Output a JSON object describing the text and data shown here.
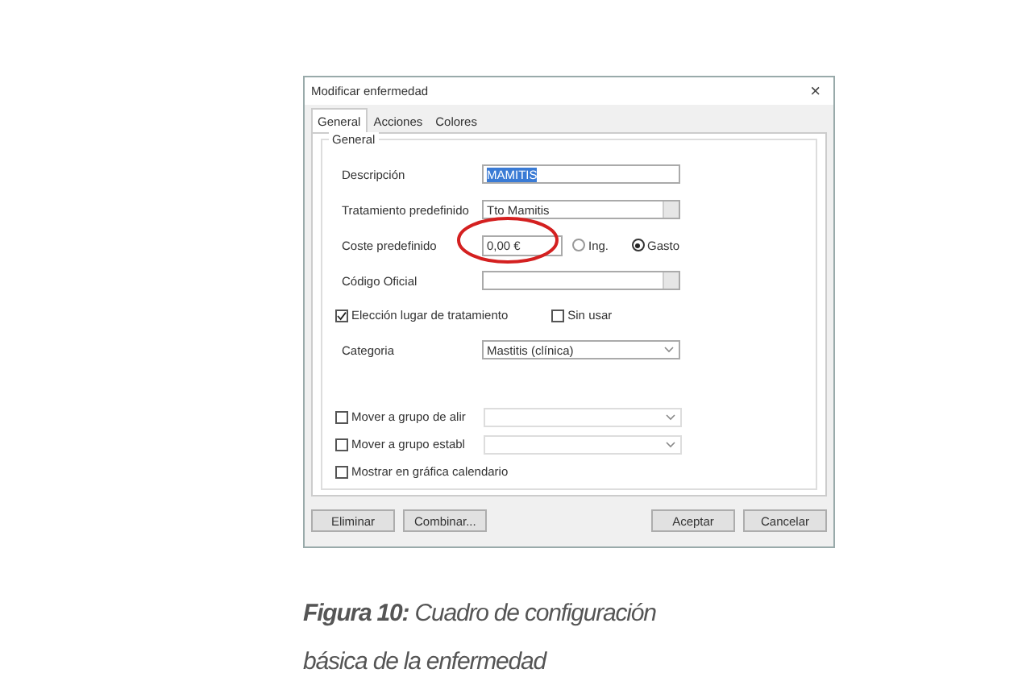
{
  "window": {
    "title": "Modificar enfermedad",
    "close": "×"
  },
  "tabs": [
    {
      "label": "General",
      "selected": true
    },
    {
      "label": "Acciones",
      "selected": false
    },
    {
      "label": "Colores",
      "selected": false
    }
  ],
  "group": {
    "title": "General"
  },
  "fields": [
    {
      "kind": "text",
      "label": "Descripción",
      "value": "MAMITIS",
      "selected_text": true
    },
    {
      "kind": "combo",
      "label": "Tratamiento predefinido",
      "value": "Tto Mamitis"
    },
    {
      "kind": "cost",
      "label": "Coste predefinido",
      "value": "0,00 €",
      "options": [
        {
          "label": "Ing.",
          "selected": false
        },
        {
          "label": "Gasto",
          "selected": true
        }
      ]
    },
    {
      "kind": "combo",
      "label": "Código Oficial"
    },
    {
      "kind": "checks",
      "items": [
        {
          "label": "Elección lugar de tratamiento",
          "checked": true
        },
        {
          "label": "Sin usar",
          "checked": false
        }
      ]
    },
    {
      "kind": "dropdown",
      "label": "Categoria",
      "value": "Mastitis (clínica)"
    }
  ],
  "moves": [
    {
      "label": "Mover a grupo de alir",
      "checked": false,
      "dropdown": true
    },
    {
      "label": "Mover a grupo establ",
      "checked": false,
      "dropdown": true
    },
    {
      "label": "Mostrar en gráfica calendario",
      "checked": false,
      "dropdown": false
    }
  ],
  "buttons_left": [
    "Eliminar",
    "Combinar..."
  ],
  "buttons_right": [
    "Aceptar",
    "Cancelar"
  ],
  "annotation": {
    "kind": "ellipse"
  },
  "caption": "**Figura 10:** Cuadro de configuración básica de la enfermedad"
}
